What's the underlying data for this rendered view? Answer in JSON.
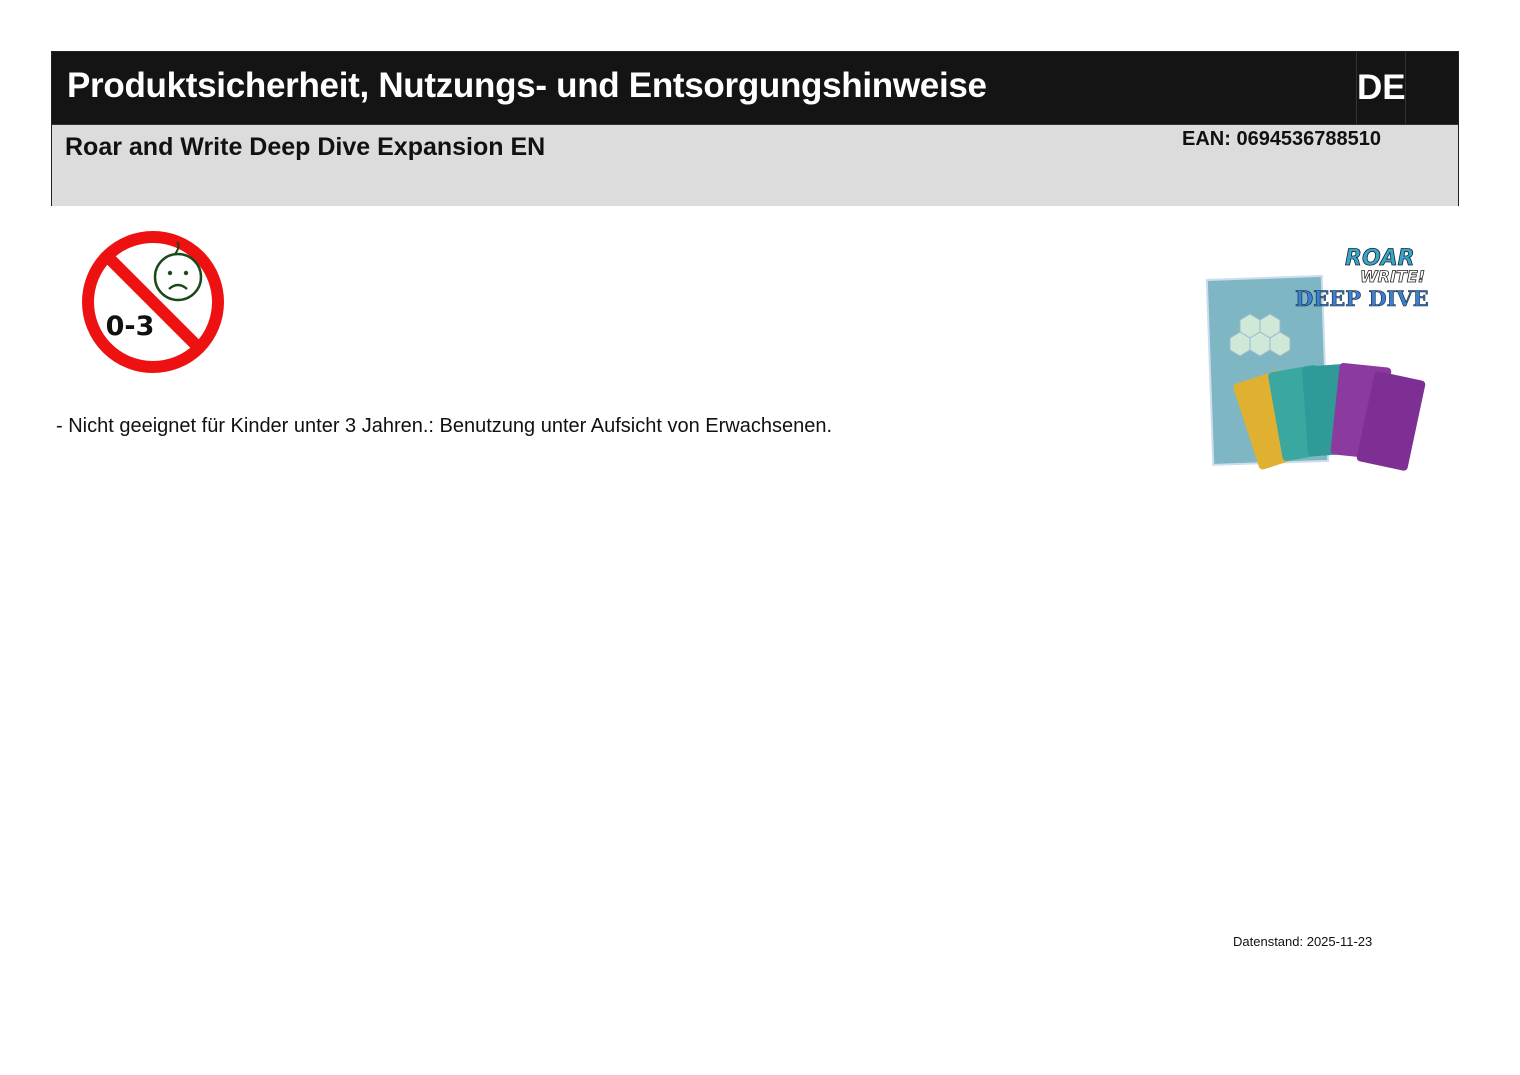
{
  "header": {
    "title": "Produktsicherheit, Nutzungs- und Entsorgungshinweise",
    "language": "DE",
    "product_name": "Roar and Write Deep Dive Expansion EN",
    "ean": "EAN: 0694536788510"
  },
  "warning_icon": {
    "label": "0-3",
    "color": "#ee1111"
  },
  "notes": [
    "- Nicht geeignet für Kinder unter 3 Jahren.: Benutzung unter Aufsicht von Erwachsenen."
  ],
  "product_image": {
    "logo_text": [
      "ROAR",
      "WRITE!",
      "DEEP DIVE"
    ]
  },
  "footer": {
    "date_stamp": "Datenstand: 2025-11-23"
  }
}
